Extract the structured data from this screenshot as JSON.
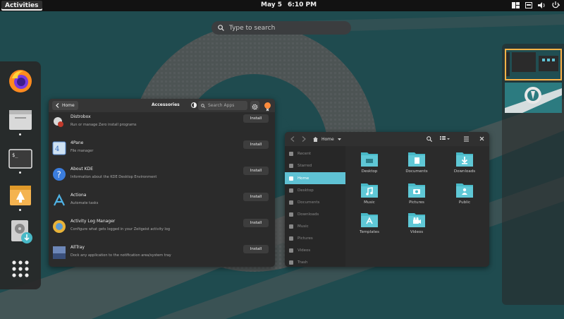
{
  "topbar": {
    "activities": "Activities",
    "date": "May 5",
    "time": "6:10 PM"
  },
  "search": {
    "placeholder": "Type to search"
  },
  "dock": {
    "items": [
      "firefox-icon",
      "files-icon",
      "terminal-icon",
      "app-store-icon",
      "installer-icon",
      "app-grid-icon"
    ]
  },
  "accessories": {
    "home": "Home",
    "title": "Accessories",
    "search_placeholder": "Search Apps",
    "apps": [
      {
        "name": "Distrobox",
        "desc": "Run or manage Zero install programs",
        "action": "Install"
      },
      {
        "name": "4Pane",
        "desc": "File manager",
        "action": "Install"
      },
      {
        "name": "About KDE",
        "desc": "Information about the KDE Desktop Environment",
        "action": "Install"
      },
      {
        "name": "Actiona",
        "desc": "Automate tasks",
        "action": "Install"
      },
      {
        "name": "Activity Log Manager",
        "desc": "Configure what gets logged in your Zeitgeist activity log",
        "action": "Install"
      },
      {
        "name": "AllTray",
        "desc": "Dock any application to the notification area/system tray",
        "action": "Install"
      }
    ]
  },
  "files": {
    "location": "Home",
    "sidebar": [
      "Recent",
      "Starred",
      "Home",
      "Desktop",
      "Documents",
      "Downloads",
      "Music",
      "Pictures",
      "Videos",
      "Trash"
    ],
    "active_sidebar": "Home",
    "folders": [
      "Desktop",
      "Documents",
      "Downloads",
      "Music",
      "Pictures",
      "Public",
      "Templates",
      "Videos"
    ]
  },
  "colors": {
    "accent": "#5fc2d4",
    "close": "#fb8b3c",
    "workspace_border": "#ffb347"
  }
}
